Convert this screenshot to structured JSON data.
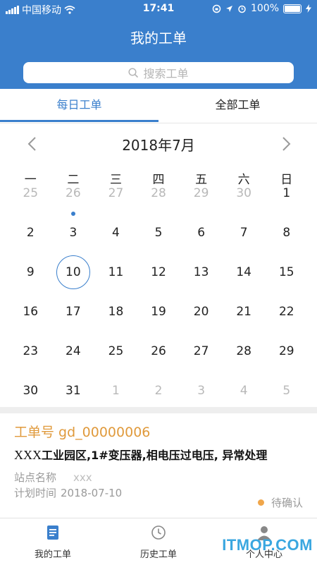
{
  "status_bar": {
    "carrier": "中国移动",
    "time": "17:41",
    "battery": "100%"
  },
  "header": {
    "title": "我的工单",
    "search_placeholder": "搜索工单"
  },
  "tabs": [
    {
      "label": "每日工单",
      "active": true
    },
    {
      "label": "全部工单",
      "active": false
    }
  ],
  "calendar": {
    "month_title": "2018年7月",
    "weekdays": [
      "一",
      "二",
      "三",
      "四",
      "五",
      "六",
      "日"
    ],
    "weeks": [
      [
        {
          "d": "25",
          "m": true
        },
        {
          "d": "26",
          "m": true
        },
        {
          "d": "27",
          "m": true
        },
        {
          "d": "28",
          "m": true
        },
        {
          "d": "29",
          "m": true
        },
        {
          "d": "30",
          "m": true
        },
        {
          "d": "1"
        }
      ],
      [
        {
          "d": "2"
        },
        {
          "d": "3",
          "dot": true
        },
        {
          "d": "4"
        },
        {
          "d": "5"
        },
        {
          "d": "6"
        },
        {
          "d": "7"
        },
        {
          "d": "8"
        }
      ],
      [
        {
          "d": "9"
        },
        {
          "d": "10",
          "today": true
        },
        {
          "d": "11"
        },
        {
          "d": "12"
        },
        {
          "d": "13"
        },
        {
          "d": "14"
        },
        {
          "d": "15"
        }
      ],
      [
        {
          "d": "16"
        },
        {
          "d": "17"
        },
        {
          "d": "18"
        },
        {
          "d": "19"
        },
        {
          "d": "20"
        },
        {
          "d": "21"
        },
        {
          "d": "22"
        }
      ],
      [
        {
          "d": "23"
        },
        {
          "d": "24"
        },
        {
          "d": "25"
        },
        {
          "d": "26"
        },
        {
          "d": "27"
        },
        {
          "d": "28"
        },
        {
          "d": "29"
        }
      ],
      [
        {
          "d": "30"
        },
        {
          "d": "31"
        },
        {
          "d": "1",
          "m": true
        },
        {
          "d": "2",
          "m": true
        },
        {
          "d": "3",
          "m": true
        },
        {
          "d": "4",
          "m": true
        },
        {
          "d": "5",
          "m": true
        }
      ]
    ]
  },
  "order_card": {
    "order_no": "工单号 gd_00000006",
    "desc_prefix": "XXX",
    "desc_rest": "工业园区,1#变压器,相电压过电压, 异常处理",
    "site_label": "站点名称",
    "site_value": "xxx",
    "plan_label": "计划时间",
    "plan_value": "2018-07-10",
    "status": "待确认"
  },
  "bottom_nav": [
    {
      "label": "我的工单",
      "icon": "document-icon"
    },
    {
      "label": "历史工单",
      "icon": "clock-icon"
    },
    {
      "label": "个人中心",
      "icon": "person-icon"
    }
  ],
  "watermark": "ITMOP.COM",
  "colors": {
    "primary": "#3a7fcc",
    "accent_orange": "#e09a3c",
    "status_dot": "#f0a64a"
  }
}
